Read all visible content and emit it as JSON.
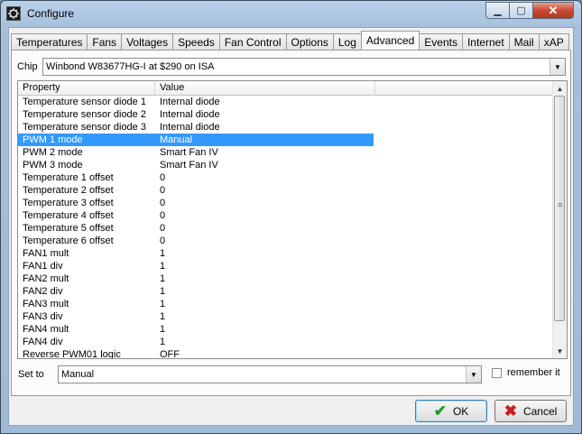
{
  "window": {
    "title": "Configure"
  },
  "tabs": [
    "Temperatures",
    "Fans",
    "Voltages",
    "Speeds",
    "Fan Control",
    "Options",
    "Log",
    "Advanced",
    "Events",
    "Internet",
    "Mail",
    "xAP"
  ],
  "active_tab": "Advanced",
  "chip": {
    "label": "Chip",
    "value": "Winbond W83677HG-I at $290 on ISA"
  },
  "grid": {
    "headers": [
      "Property",
      "Value"
    ],
    "selected_row": 3,
    "rows": [
      {
        "property": "Temperature sensor diode 1",
        "value": "Internal diode"
      },
      {
        "property": "Temperature sensor diode 2",
        "value": "Internal diode"
      },
      {
        "property": "Temperature sensor diode 3",
        "value": "Internal diode"
      },
      {
        "property": "PWM 1 mode",
        "value": "Manual"
      },
      {
        "property": "PWM 2 mode",
        "value": "Smart Fan IV"
      },
      {
        "property": "PWM 3 mode",
        "value": "Smart Fan IV"
      },
      {
        "property": "Temperature 1 offset",
        "value": "0"
      },
      {
        "property": "Temperature 2 offset",
        "value": "0"
      },
      {
        "property": "Temperature 3 offset",
        "value": "0"
      },
      {
        "property": "Temperature 4 offset",
        "value": "0"
      },
      {
        "property": "Temperature 5 offset",
        "value": "0"
      },
      {
        "property": "Temperature 6 offset",
        "value": "0"
      },
      {
        "property": "FAN1 mult",
        "value": "1"
      },
      {
        "property": "FAN1 div",
        "value": "1"
      },
      {
        "property": "FAN2 mult",
        "value": "1"
      },
      {
        "property": "FAN2 div",
        "value": "1"
      },
      {
        "property": "FAN3 mult",
        "value": "1"
      },
      {
        "property": "FAN3 div",
        "value": "1"
      },
      {
        "property": "FAN4 mult",
        "value": "1"
      },
      {
        "property": "FAN4 div",
        "value": "1"
      },
      {
        "property": "Reverse PWM01 logic",
        "value": "OFF"
      }
    ]
  },
  "set_to": {
    "label": "Set to",
    "value": "Manual"
  },
  "remember": {
    "label": "remember it",
    "checked": false
  },
  "buttons": {
    "ok": "OK",
    "cancel": "Cancel"
  },
  "colors": {
    "selection": "#3399ff",
    "ok_icon": "#1f9c2a",
    "cancel_icon": "#c8201c"
  }
}
